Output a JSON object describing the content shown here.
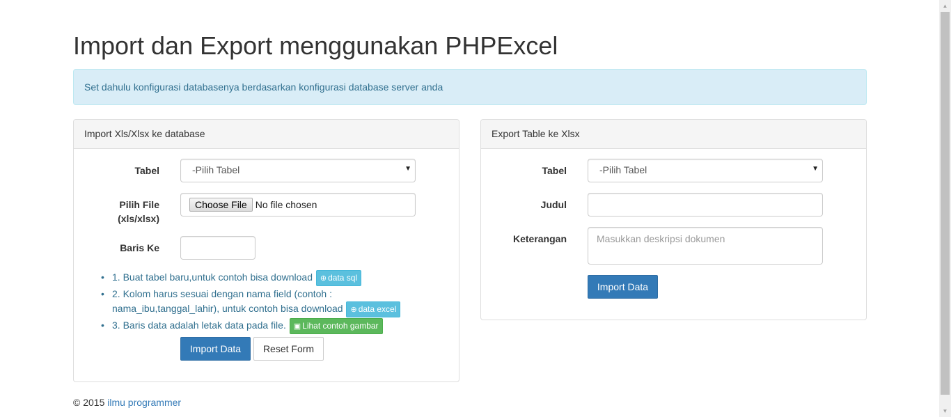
{
  "page": {
    "title": "Import dan Export menggunakan PHPExcel",
    "alert": "Set dahulu konfigurasi databasenya berdasarkan konfigurasi database server anda"
  },
  "import_panel": {
    "heading": "Import Xls/Xlsx ke database",
    "tabel_label": "Tabel",
    "tabel_select": "-Pilih Tabel",
    "file_label_line1": "Pilih File",
    "file_label_line2": "(xls/xlsx)",
    "file_button": "Choose File",
    "file_status": "No file chosen",
    "baris_label": "Baris Ke",
    "baris_value": "",
    "steps": [
      {
        "text": "1. Buat tabel baru,untuk contoh bisa download",
        "button": "data sql"
      },
      {
        "text": "2. Kolom harus sesuai dengan nama field (contoh : nama_ibu,tanggal_lahir), untuk contoh bisa download",
        "button": "data excel"
      },
      {
        "text": "3. Baris data adalah letak data pada file.",
        "button": "Lihat contoh gambar"
      }
    ],
    "import_button": "Import Data",
    "reset_button": "Reset Form"
  },
  "export_panel": {
    "heading": "Export Table ke Xlsx",
    "tabel_label": "Tabel",
    "tabel_select": "-Pilih Tabel",
    "judul_label": "Judul",
    "judul_value": "",
    "keterangan_label": "Keterangan",
    "keterangan_placeholder": "Masukkan deskripsi dokumen",
    "import_button": "Import Data"
  },
  "footer": {
    "copyright": "© 2015",
    "link": "ilmu programmer"
  },
  "colors": {
    "primary": "#337ab7",
    "info": "#5bc0de",
    "success": "#5cb85c",
    "alert_bg": "#d9edf7",
    "alert_text": "#31708f"
  },
  "icons": {
    "download": "download-circle-icon",
    "picture": "picture-icon",
    "select": "dropdown-arrow-icon"
  }
}
